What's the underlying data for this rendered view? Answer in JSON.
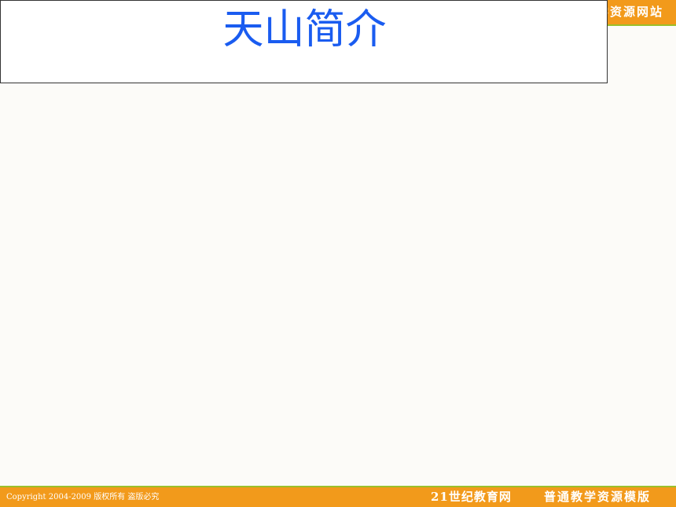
{
  "header": {
    "banner_text": "普通教学资源网站"
  },
  "slide": {
    "title": "天山简介"
  },
  "footer": {
    "copyright": "Copyright 2004-2009 版权所有 盗版必究",
    "site_name": "21世纪教育网",
    "template_name": "普通教学资源模版"
  },
  "colors": {
    "banner": "#f29a1b",
    "accent_line": "#9bbf2a",
    "title": "#1a5cf0",
    "slide_background": "#fcfbf8"
  }
}
